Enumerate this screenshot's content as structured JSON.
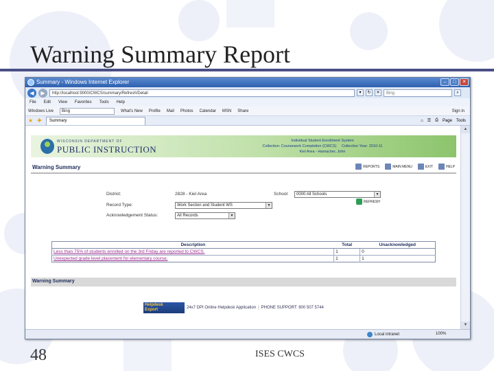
{
  "slide": {
    "title": "Warning Summary Report",
    "page_number": "48",
    "footer": "ISES CWCS"
  },
  "browser": {
    "window_title": "Summary - Windows Internet Explorer",
    "url": "http://localhost:9000/CWCS/summary/Refresh/Detail",
    "search_placeholder": "Bing",
    "menu": [
      "File",
      "Edit",
      "View",
      "Favorites",
      "Tools",
      "Help"
    ],
    "windows_live_label": "Windows Live",
    "windows_live_value": "Bing",
    "links": [
      "What's New",
      "Profile",
      "Mail",
      "Photos",
      "Calendar",
      "MSN",
      "Share"
    ],
    "sign_in": "Sign in",
    "tab_title": "Summary",
    "page_menu": "Page",
    "tools_menu": "Tools",
    "status_zone": "Local intranet",
    "zoom": "100%"
  },
  "banner": {
    "logo_small": "WISCONSIN DEPARTMENT OF",
    "logo_big": "PUBLIC INSTRUCTION",
    "system_name": "Individual Student Enrollment System",
    "collection": "Collection: Coursework Completion (CWCS)",
    "collection_year": "Collection Year: 2010-11",
    "user": "Kiel Area - Hamacher, John"
  },
  "header": {
    "title": "Warning Summary",
    "actions": [
      "REPORTS",
      "MAIN MENU",
      "EXIT",
      "HELP"
    ]
  },
  "form": {
    "district_label": "District:",
    "district_value": "2828 - Kiel Area",
    "school_label": "School:",
    "school_value": "0000 All Schools",
    "record_type_label": "Record Type:",
    "record_type_value": "Work Section and Student WS",
    "ack_status_label": "Acknowledgement Status:",
    "ack_status_value": "All Records",
    "refresh_label": "REFRESH"
  },
  "table": {
    "headers": [
      "Description",
      "Total",
      "Unacknowledged"
    ],
    "rows": [
      {
        "description": "Less than 75% of students enrolled on the 3rd Friday are reported to CWCS.",
        "total": "1",
        "unack": "0"
      },
      {
        "description": "Unexpected grade level placement for elementary course.",
        "total": "1",
        "unack": "1"
      }
    ]
  },
  "footer_section": {
    "title": "Warning Summary"
  },
  "helpdesk": {
    "logo_line1": "Helpdesk",
    "logo_line2": "Export",
    "app_text": "24x7 DPI Online Helpdesk Application",
    "phone_text": "PHONE SUPPORT: 800 507 5744"
  }
}
